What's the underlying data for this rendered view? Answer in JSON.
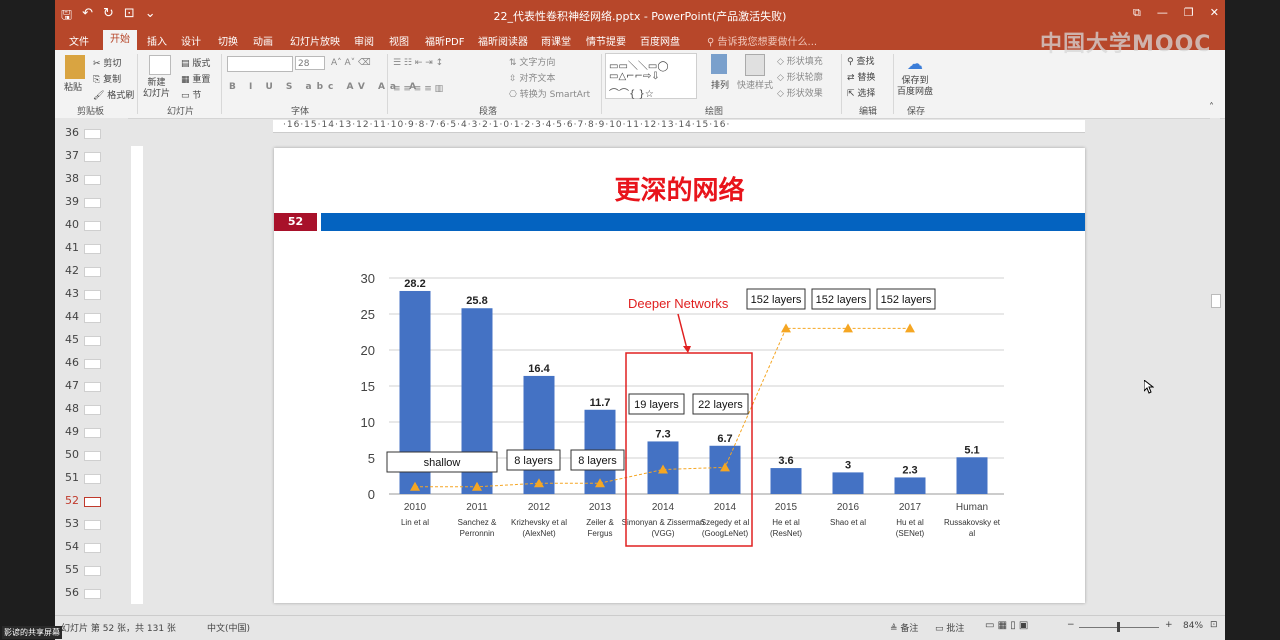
{
  "window": {
    "title": "22_代表性卷积神经网络.pptx - PowerPoint(产品激活失败)",
    "controls": [
      "⧉",
      "—",
      "❐",
      "✕"
    ]
  },
  "watermark": "中国大学MOOC",
  "tabs": [
    "文件",
    "开始",
    "插入",
    "设计",
    "切换",
    "动画",
    "幻灯片放映",
    "审阅",
    "视图",
    "福昕PDF",
    "福昕阅读器",
    "雨课堂",
    "情节提要",
    "百度网盘"
  ],
  "tell_me": "告诉我您想要做什么...",
  "ribbon": {
    "clipboard": {
      "paste": "粘贴",
      "cut": "剪切",
      "copy": "复制",
      "format_painter": "格式刷",
      "label": "剪贴板"
    },
    "slides": {
      "new_slide": "新建\n幻灯片",
      "layout": "版式",
      "reset": "重置",
      "section": "节",
      "label": "幻灯片"
    },
    "font": {
      "size": "28",
      "label": "字体"
    },
    "paragraph": {
      "text_direction": "文字方向",
      "align_text": "对齐文本",
      "smartart": "转换为 SmartArt",
      "label": "段落"
    },
    "drawing": {
      "arrange": "排列",
      "quick_styles": "快速样式",
      "shape_fill": "形状填充",
      "shape_outline": "形状轮廓",
      "shape_effects": "形状效果",
      "label": "绘图"
    },
    "editing": {
      "find": "查找",
      "replace": "替换",
      "select": "选择",
      "label": "编辑"
    },
    "save": {
      "save_to": "保存到\n百度网盘",
      "label": "保存"
    }
  },
  "thumbnails": {
    "numbers": [
      "36",
      "37",
      "38",
      "39",
      "40",
      "41",
      "42",
      "43",
      "44",
      "45",
      "46",
      "47",
      "48",
      "49",
      "50",
      "51",
      "52",
      "53",
      "54",
      "55",
      "56"
    ],
    "selected": "52"
  },
  "ruler": "·16·15·14·13·12·11·10·9·8·7·6·5·4·3·2·1·0·1·2·3·4·5·6·7·8·9·10·11·12·13·14·15·16·",
  "slide": {
    "title": "更深的网络",
    "number": "52"
  },
  "chart_data": {
    "type": "bar",
    "categories": [
      "2010",
      "2011",
      "2012",
      "2013",
      "2014",
      "2014",
      "2015",
      "2016",
      "2017",
      "Human"
    ],
    "sub_labels": [
      "Lin et al",
      "Sanchez & Perronnin",
      "Krizhevsky et al (AlexNet)",
      "Zeiler & Fergus",
      "Simonyan & Zisserman (VGG)",
      "Szegedy et al (GoogLeNet)",
      "He et al (ResNet)",
      "Shao et al",
      "Hu et al (SENet)",
      "Russakovsky et al"
    ],
    "values": [
      28.2,
      25.8,
      16.4,
      11.7,
      7.3,
      6.7,
      3.6,
      3,
      2.3,
      5.1
    ],
    "value_labels": [
      "28.2",
      "25.8",
      "16.4",
      "11.7",
      "7.3",
      "6.7",
      "3.6",
      "3",
      "2.3",
      "5.1"
    ],
    "yticks": [
      "0",
      "5",
      "10",
      "15",
      "20",
      "25",
      "30"
    ],
    "ylim": [
      0,
      30
    ],
    "bar_color": "#4472c4",
    "depth_trend": {
      "values": [
        1,
        1,
        1.5,
        1.5,
        3.4,
        3.7,
        23,
        23,
        23
      ],
      "color": "#f5a623"
    },
    "layer_boxes": [
      "shallow",
      "8 layers",
      "8 layers",
      "19 layers",
      "22 layers",
      "152 layers",
      "152 layers",
      "152 layers"
    ],
    "annotation": "Deeper Networks",
    "annotation_color": "#e02020"
  },
  "status": {
    "slide_info": "幻灯片 第 52 张，共 131 张",
    "language": "中文(中国)",
    "notes": "备注",
    "comments": "批注",
    "zoom": "84%",
    "screen_share": "影谚的共享屏幕"
  }
}
